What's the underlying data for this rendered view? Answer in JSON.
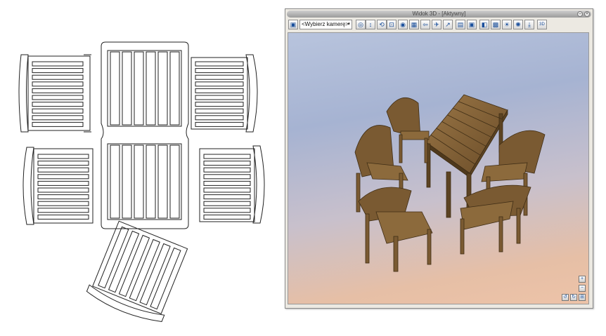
{
  "window": {
    "title": "Widok 3D - [Aktywny]",
    "minimize_glyph": "–",
    "close_glyph": "×"
  },
  "toolbar": {
    "camera_select": {
      "value": "<Wybierz kamerę>",
      "arrow": "▾"
    },
    "buttons": [
      {
        "name": "render-icon",
        "glyph": "◎"
      },
      {
        "name": "pan-icon",
        "glyph": "↕"
      },
      {
        "name": "orbit-icon",
        "glyph": "⟲"
      },
      {
        "name": "zoom-window-icon",
        "glyph": "⊡"
      },
      {
        "name": "camera-icon",
        "glyph": "◉"
      },
      {
        "name": "grid-icon",
        "glyph": "▦"
      },
      {
        "name": "walk-icon",
        "glyph": "⇦"
      },
      {
        "name": "fly-icon",
        "glyph": "✈"
      },
      {
        "name": "move-icon",
        "glyph": "↗"
      },
      {
        "name": "print-icon",
        "glyph": "▤"
      },
      {
        "name": "save-image-icon",
        "glyph": "▣"
      },
      {
        "name": "materials-icon",
        "glyph": "◧"
      },
      {
        "name": "textures-icon",
        "glyph": "▩"
      },
      {
        "name": "light-icon",
        "glyph": "☀"
      },
      {
        "name": "sun-icon",
        "glyph": "✺"
      },
      {
        "name": "export-icon",
        "glyph": "⤓"
      },
      {
        "name": "view-3d-icon",
        "glyph": "3D"
      }
    ]
  },
  "viewport_controls": {
    "zoom_in": "+",
    "zoom_out": "−",
    "rotate_left": "↺",
    "rotate_right": "↻",
    "fit": "⊞"
  },
  "colors": {
    "wood": "#7a5a32",
    "wood_dark": "#4f391c",
    "wood_light": "#9a7646",
    "line": "#222222"
  }
}
